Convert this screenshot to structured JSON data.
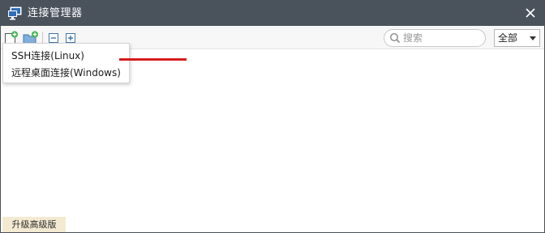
{
  "window": {
    "title": "连接管理器"
  },
  "toolbar": {
    "search_placeholder": "搜索",
    "filter_selected": "全部"
  },
  "menu": {
    "items": [
      {
        "label": "SSH连接(Linux)"
      },
      {
        "label": "远程桌面连接(Windows)"
      }
    ]
  },
  "footer": {
    "upgrade_label": "升级高级版"
  },
  "colors": {
    "titlebar": "#4a525c",
    "accent_green": "#3bb54a",
    "annotation_red": "#d51c1c",
    "upgrade_bg": "#f4ead2"
  },
  "icons": {
    "app": "connection-monitor-icon",
    "close": "close-icon",
    "new_connection": "new-connection-icon",
    "new_folder": "new-folder-icon",
    "collapse": "collapse-all-icon",
    "expand": "expand-all-icon",
    "search": "search-icon",
    "dropdown": "chevron-down-icon"
  }
}
